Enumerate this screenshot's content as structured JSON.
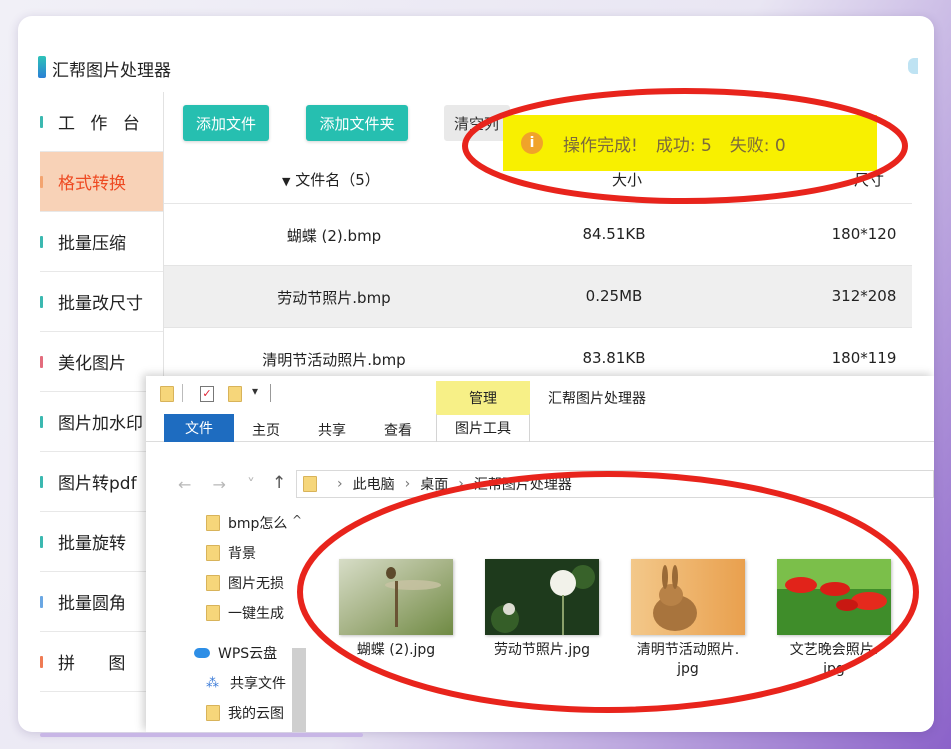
{
  "app": {
    "title": "汇帮图片处理器"
  },
  "sidebar": {
    "items": [
      {
        "label": "工 作 台"
      },
      {
        "label": "格式转换"
      },
      {
        "label": "批量压缩"
      },
      {
        "label": "批量改尺寸"
      },
      {
        "label": "美化图片"
      },
      {
        "label": "图片加水印"
      },
      {
        "label": "图片转pdf"
      },
      {
        "label": "批量旋转"
      },
      {
        "label": "批量圆角"
      },
      {
        "label": "拼 图"
      }
    ]
  },
  "toolbar": {
    "add_file": "添加文件",
    "add_folder": "添加文件夹",
    "clear_list": "清空列"
  },
  "table": {
    "header": {
      "filename": "文件名（5）",
      "size": "大小",
      "dimensions": "尺寸"
    },
    "rows": [
      {
        "name": "蝴蝶 (2).bmp",
        "size": "84.51KB",
        "dim": "180*120"
      },
      {
        "name": "劳动节照片.bmp",
        "size": "0.25MB",
        "dim": "312*208"
      },
      {
        "name": "清明节活动照片.bmp",
        "size": "83.81KB",
        "dim": "180*119"
      }
    ]
  },
  "toast": {
    "message": "操作完成!",
    "success": "成功: 5",
    "fail": "失败: 0"
  },
  "explorer": {
    "title": "汇帮图片处理器",
    "manage_tab": "管理",
    "ribbon": {
      "file": "文件",
      "home": "主页",
      "share": "共享",
      "view": "查看",
      "picture_tools": "图片工具"
    },
    "path": [
      "此电脑",
      "桌面",
      "汇帮图片处理器"
    ],
    "nav_items": [
      {
        "label": "bmp怎么"
      },
      {
        "label": "背景"
      },
      {
        "label": "图片无损"
      },
      {
        "label": "一键生成"
      },
      {
        "label": "WPS云盘"
      },
      {
        "label": "共享文件"
      },
      {
        "label": "我的云图"
      }
    ],
    "files": [
      {
        "line1": "蝴蝶 (2).jpg",
        "line2": ""
      },
      {
        "line1": "劳动节照片.jpg",
        "line2": ""
      },
      {
        "line1": "清明节活动照片.",
        "line2": "jpg"
      },
      {
        "line1": "文艺晚会照片.",
        "line2": "jpg"
      }
    ]
  },
  "colors": {
    "accent": "#26bfb0",
    "active_bg": "#f8d2b7",
    "active_text": "#ee4a22",
    "toast_bg": "#f8f000",
    "annotation_red": "#e8241c",
    "ribbon_blue": "#1e6cc0"
  },
  "icons": {
    "toast": "info-icon",
    "explorer_folder": "folder-icon",
    "up": "arrow-up-icon",
    "cloud": "cloud-icon"
  }
}
